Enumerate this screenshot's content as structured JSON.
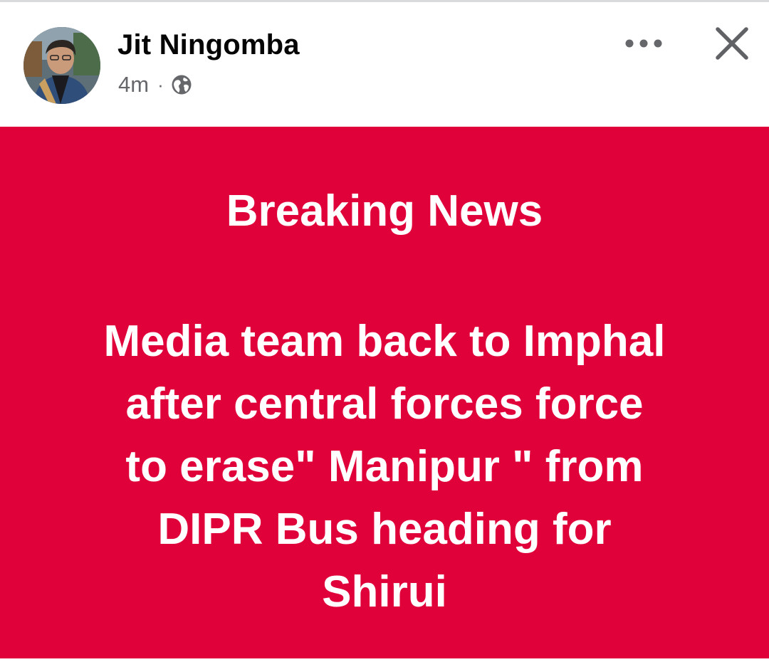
{
  "post": {
    "author_name": "Jit Ningomba",
    "timestamp": "4m",
    "separator": "·",
    "privacy_icon": "globe-icon",
    "actions": {
      "more_icon": "more-horizontal-icon",
      "close_icon": "close-icon"
    }
  },
  "card": {
    "background_color": "#e0003a",
    "text_color": "#ffffff",
    "headline": "Breaking News",
    "body": "Media team back to Imphal\nafter central forces force\nto erase\" Manipur \" from\nDIPR Bus heading for\nShirui"
  }
}
